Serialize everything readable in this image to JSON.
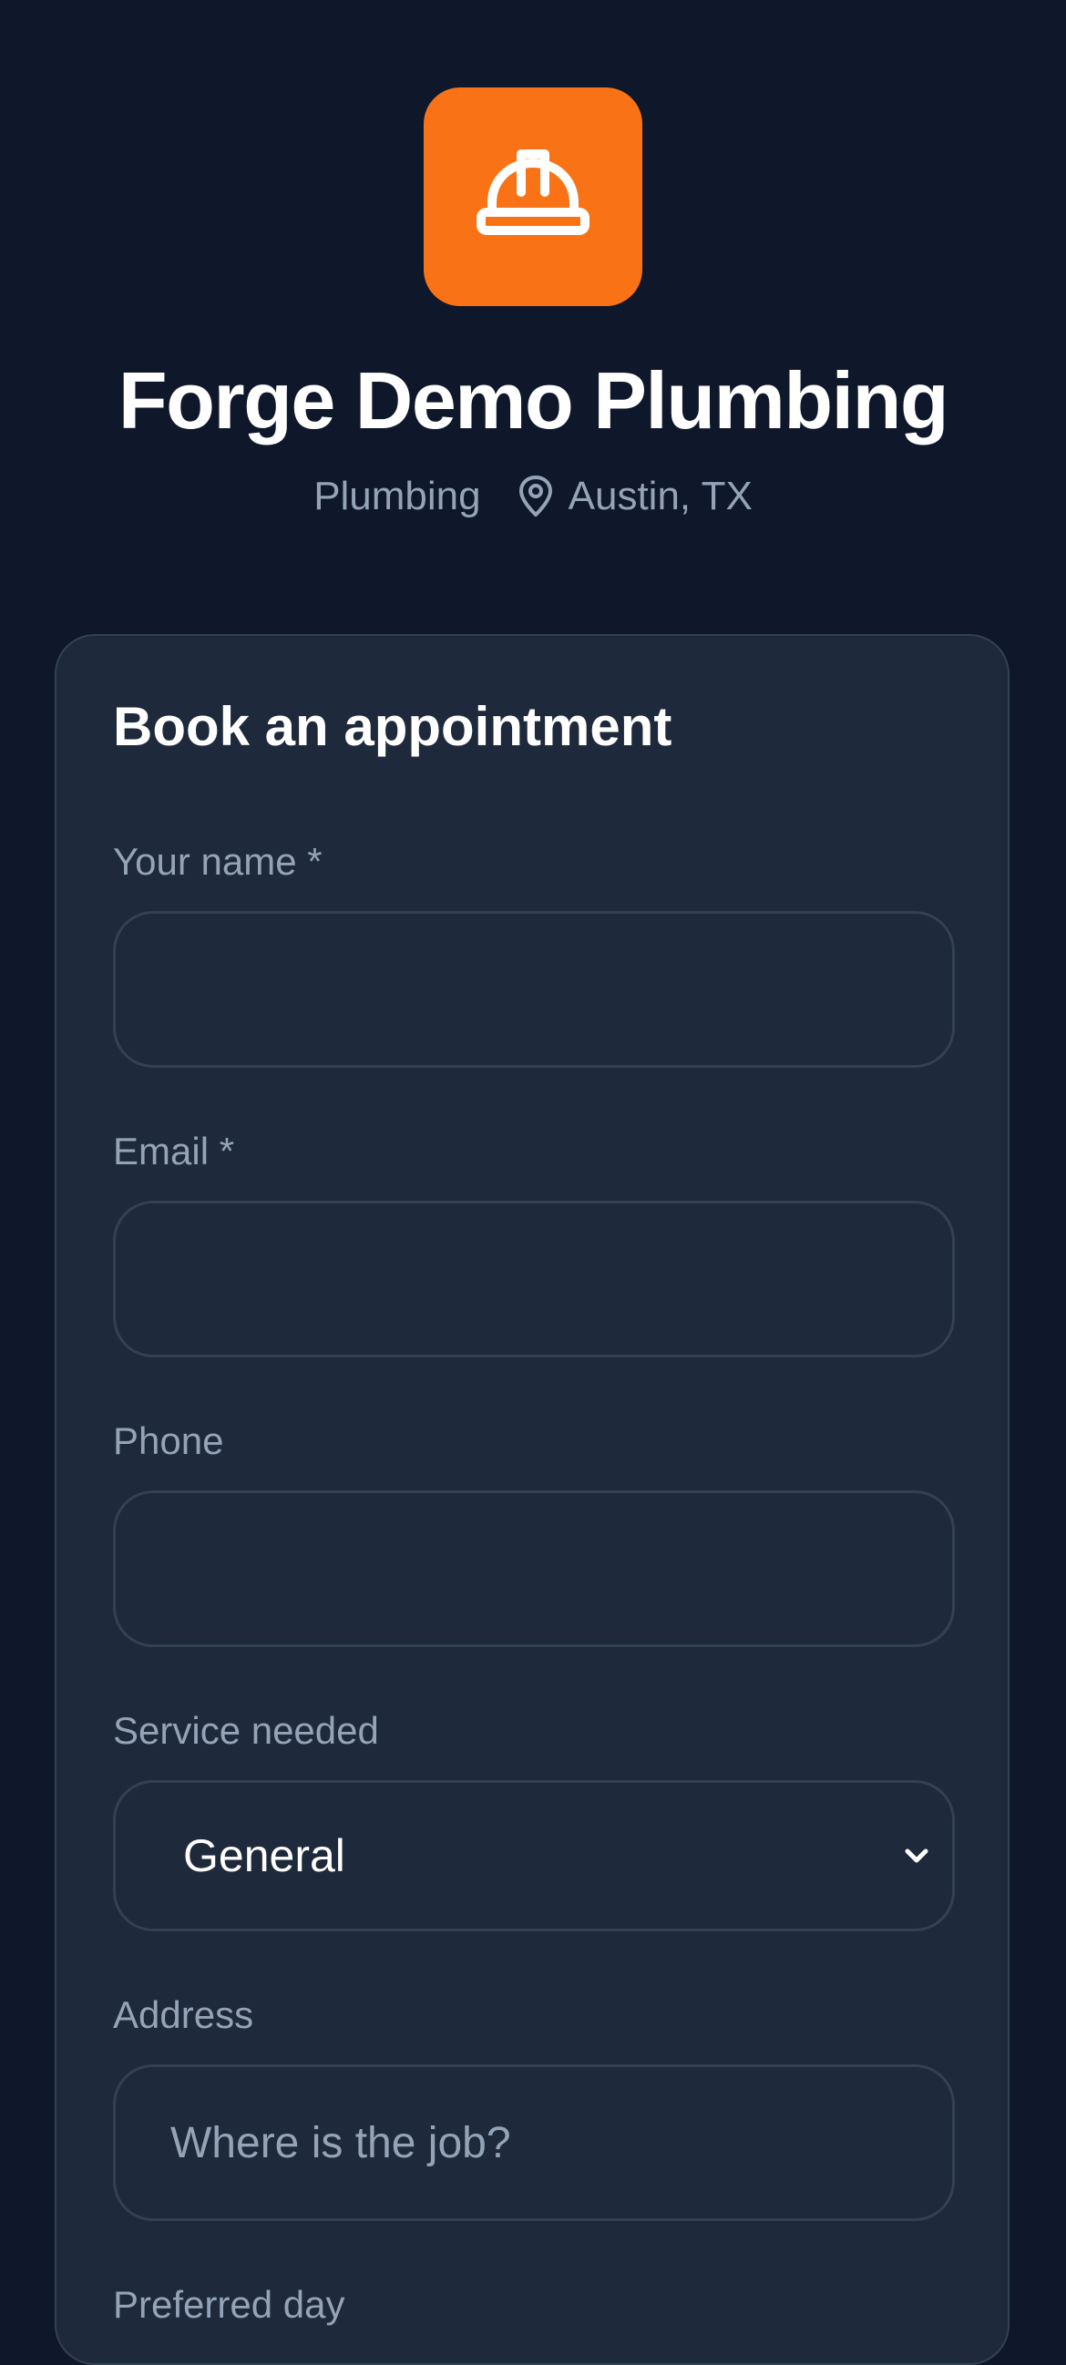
{
  "business": {
    "name": "Forge Demo Plumbing",
    "category": "Plumbing",
    "location": "Austin, TX"
  },
  "icons": {
    "logo": "hard-hat-icon",
    "location": "map-pin-icon",
    "select": "chevron-down-icon"
  },
  "colors": {
    "background": "#0f172a",
    "card": "#1e293b",
    "accent": "#f97316",
    "muted_text": "#94a3b8",
    "border": "#334155"
  },
  "form": {
    "title": "Book an appointment",
    "name_label": "Your name *",
    "name_value": "",
    "email_label": "Email *",
    "email_value": "",
    "phone_label": "Phone",
    "phone_value": "",
    "service_label": "Service needed",
    "service_value": "General",
    "address_label": "Address",
    "address_placeholder": "Where is the job?",
    "preferred_day_label": "Preferred day"
  }
}
